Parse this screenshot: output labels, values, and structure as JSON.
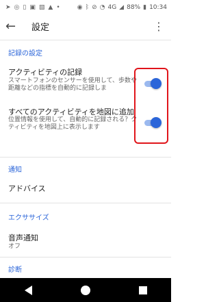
{
  "status_bar": {
    "left_icons": [
      "navigation-icon",
      "instagram-icon",
      "vibration-icon",
      "ta-icon",
      "image-icon",
      "warning-icon",
      "dot-icon"
    ],
    "right_icons": [
      "location-icon",
      "bluetooth-icon",
      "mute-icon",
      "wifi-icon",
      "lte-icon",
      "signal-icon",
      "battery-icon"
    ],
    "lte": "4G",
    "battery": "88%",
    "time": "10:34"
  },
  "app_bar": {
    "title": "設定"
  },
  "sections": {
    "recording": "記録の設定",
    "notifications": "通知",
    "exercise": "エクササイズ",
    "diagnostics": "診断"
  },
  "items": {
    "activity_recording": {
      "title": "アクティビティの記録",
      "subtitle": "スマートフォンのセンサーを使用して、歩数や距離などの指標を自動的に記録しま",
      "enabled": true
    },
    "add_to_map": {
      "title": "すべてのアクティビティを地図に追加",
      "subtitle": "位置情報を使用して、自動的に記録される？クティビティを地図上に表示します",
      "enabled": true
    },
    "advice": {
      "title": "アドバイス"
    },
    "voice_notification": {
      "title": "音声通知",
      "value": "オフ"
    }
  },
  "colors": {
    "accent": "#2b65d9",
    "highlight": "#e0141a"
  }
}
